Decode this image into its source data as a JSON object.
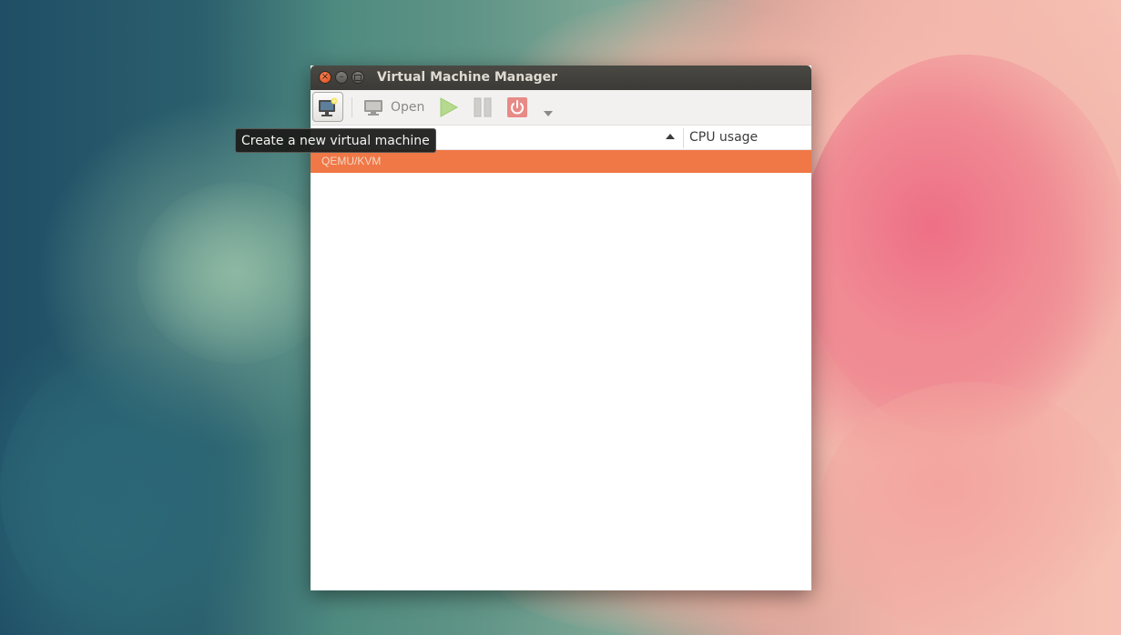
{
  "window": {
    "title": "Virtual Machine Manager"
  },
  "toolbar": {
    "new_vm_tooltip": "Create a new virtual machine",
    "open_label": "Open",
    "icons": {
      "new_vm": "new-vm-icon",
      "open": "monitor-icon",
      "run": "play-icon",
      "pause": "pause-icon",
      "shutdown": "power-icon",
      "menu": "chevron-down-icon"
    }
  },
  "list": {
    "columns": {
      "cpu_usage": "CPU usage"
    },
    "rows": [
      {
        "label": "QEMU/KVM",
        "selected": true
      }
    ]
  },
  "colors": {
    "selection": "#f07746",
    "titlebar": "#3b3a36",
    "close_button": "#df4a16",
    "run_icon": "#9acb6a",
    "shutdown_icon": "#e86a6a"
  }
}
